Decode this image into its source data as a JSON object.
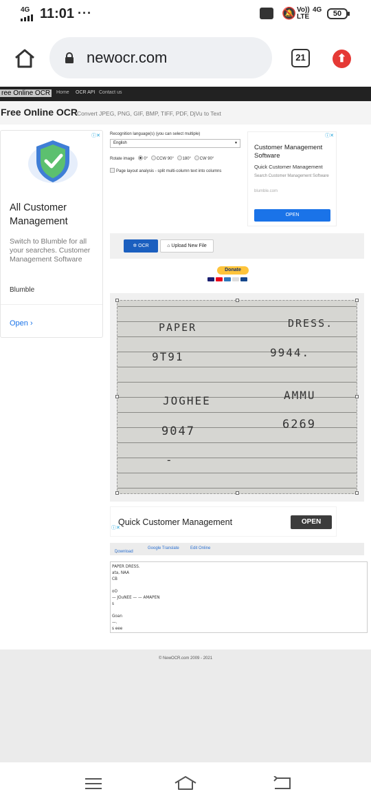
{
  "status_bar": {
    "network": "4G",
    "time": "11:01",
    "more": "···",
    "volte": "Vo)) LTE",
    "lte": "4G",
    "battery": "50"
  },
  "browser": {
    "url": "newocr.com",
    "tab_count": "21"
  },
  "site": {
    "brand": "ree Online OCR",
    "nav": [
      "Home",
      "OCR API",
      "Contact us"
    ],
    "title": "Free Online OCR",
    "subtitle": "Convert JPEG, PNG, GIF, BMP, TIFF, PDF, DjVu to Text"
  },
  "left_ad": {
    "heading": "All Customer Management",
    "description": "Switch to Blumble for all your searches. Customer Management Software",
    "sponsor": "Blumble",
    "open": "Open"
  },
  "options": {
    "language_label": "Recognition language(s) (you can select multiple)",
    "language_value": "English",
    "rotate_label": "Rotate image",
    "rotate_options": [
      "0°",
      "CCW 90°",
      "180°",
      "CW 90°"
    ],
    "layout_label": "Page layout analysis - split multi-column text into columns"
  },
  "right_ad": {
    "heading": "Customer Management Software",
    "sub": "Quick Customer Management",
    "desc": "Search Customer Management Software",
    "url": "blumble.com",
    "button": "OPEN"
  },
  "actions": {
    "ocr": "OCR",
    "upload": "Upload New File",
    "donate": "Donate"
  },
  "image_text": {
    "line1_left": "PAPER",
    "line1_right": "DRESS.",
    "line2_left": "9T91",
    "line2_right": "9944.",
    "line3_left": "JOGHEE",
    "line3_right": "AMMU",
    "line4_left": "9047",
    "line4_right": "6269",
    "line5_left": "-"
  },
  "bottom_ad": {
    "heading": "Quick Customer Management",
    "button": "OPEN"
  },
  "result_toolbar": {
    "download": "Download",
    "translate": "Google Translate",
    "edit": "Edit Online"
  },
  "result_text": "PAPER DRESS.\nata, NAA\nCB\n\noO\n— JOuNEE — — AMAPEN\ns\n\nGoan\n—.\ns eee",
  "footer": "© NewOCR.com 2009 - 2021",
  "colors": {
    "accent": "#1b5fbf",
    "update": "#e53935",
    "donate": "#fec43b"
  }
}
